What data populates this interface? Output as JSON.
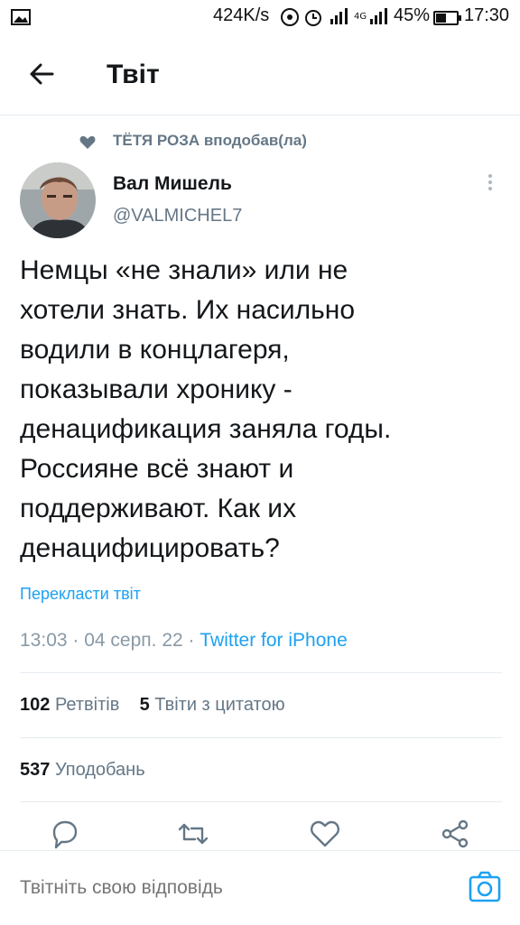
{
  "status_bar": {
    "speed": "424K/s",
    "battery": "45%",
    "time": "17:30"
  },
  "header": {
    "title": "Твіт"
  },
  "social_context": {
    "text": "ТЁТЯ РОЗА вподобав(ла)"
  },
  "author": {
    "name": "Вал Мишель",
    "handle": "@VALMICHEL7"
  },
  "tweet": {
    "text": "Немцы «не знали» или не\nхотели знать. Их насильно\nводили в концлагеря,\nпоказывали хронику -\nденацификация заняла годы.\nРоссияне всё знают и\nподдерживают. Как их\nденацифицировать?",
    "translate_link": "Перекласти твіт",
    "time": "13:03",
    "date": "04 серп. 22",
    "source": "Twitter for iPhone"
  },
  "stats": {
    "retweets_count": "102",
    "retweets_label": "Ретвітів",
    "quotes_count": "5",
    "quotes_label": "Твіти з цитатою",
    "likes_count": "537",
    "likes_label": "Уподобань"
  },
  "reply": {
    "placeholder": "Твітніть свою відповідь"
  },
  "colors": {
    "accent": "#1da1f2",
    "secondary_text": "#657786"
  }
}
